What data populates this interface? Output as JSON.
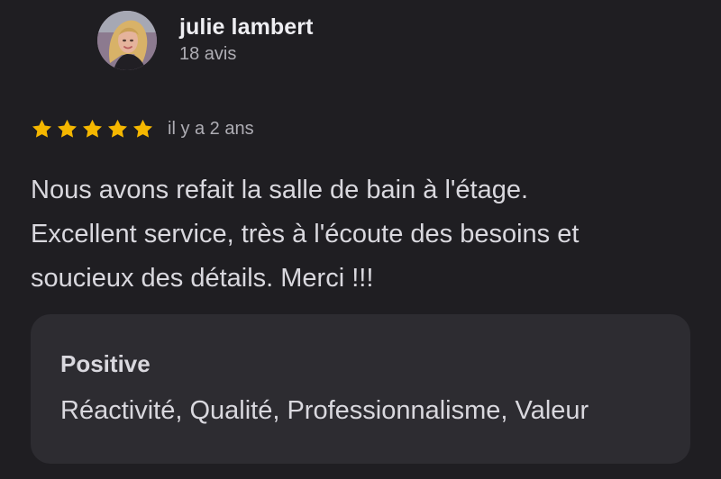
{
  "reviewer": {
    "name": "julie lambert",
    "reviews_count": "18 avis"
  },
  "review": {
    "rating": 5,
    "max_rating": 5,
    "date": "il y a 2 ans",
    "lines": [
      "Nous avons refait la salle de bain à l'étage.",
      "Excellent service, très à l'écoute des besoins et",
      "soucieux des détails. Merci !!!"
    ]
  },
  "summary": {
    "title": "Positive",
    "values": "Réactivité, Qualité, Professionnalisme, Valeur"
  },
  "colors": {
    "background": "#1f1e22",
    "card": "#2d2c31",
    "star": "#f5b700",
    "text": "#d9d8de",
    "secondary_text": "#aeadb4"
  }
}
